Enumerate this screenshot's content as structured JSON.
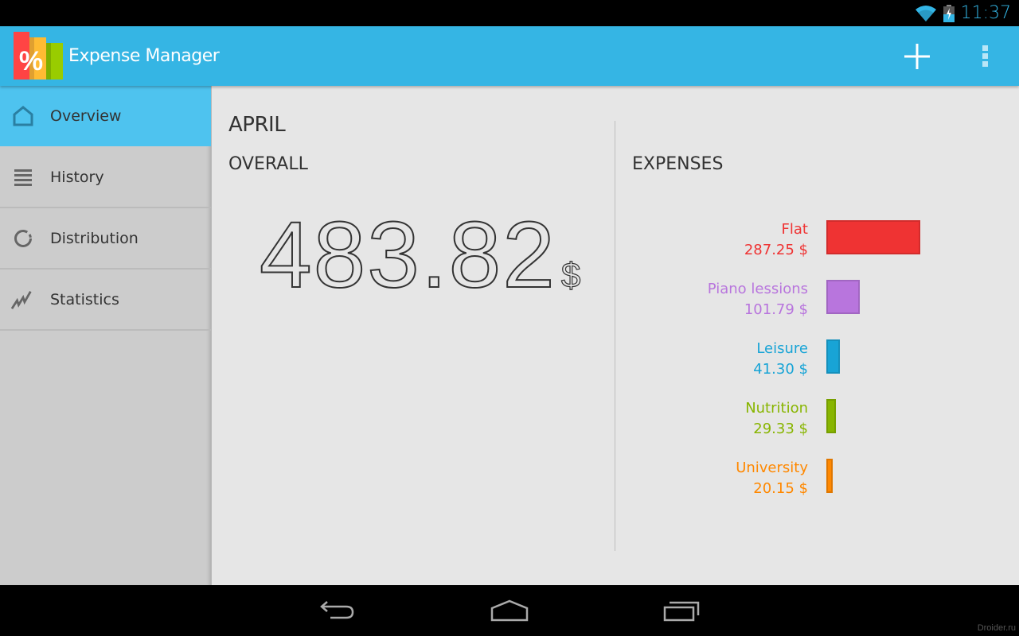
{
  "status_bar": {
    "time": "11:37",
    "icons": [
      "wifi-icon",
      "battery-charging-icon"
    ]
  },
  "action_bar": {
    "title": "Expense Manager",
    "logo_glyph": "%",
    "add_icon": "plus-icon",
    "overflow_icon": "overflow-menu-icon",
    "colors": {
      "background": "#35b5e4"
    }
  },
  "sidebar": {
    "items": [
      {
        "label": "Overview",
        "icon": "home-icon",
        "active": true
      },
      {
        "label": "History",
        "icon": "list-icon",
        "active": false
      },
      {
        "label": "Distribution",
        "icon": "donut-icon",
        "active": false
      },
      {
        "label": "Statistics",
        "icon": "chart-line-icon",
        "active": false
      }
    ]
  },
  "overview": {
    "month": "APRIL",
    "overall_label": "OVERALL",
    "total": "483.82",
    "currency": "$",
    "expenses_label": "EXPENSES",
    "expenses": [
      {
        "name": "Flat",
        "amount": "287.25 $",
        "value": 287.25,
        "color": "#ef3333"
      },
      {
        "name": "Piano lessions",
        "amount": "101.79 $",
        "value": 101.79,
        "color": "#b875dd"
      },
      {
        "name": "Leisure",
        "amount": "41.30 $",
        "value": 41.3,
        "color": "#18a4d6"
      },
      {
        "name": "Nutrition",
        "amount": "29.33 $",
        "value": 29.33,
        "color": "#88b500"
      },
      {
        "name": "University",
        "amount": "20.15 $",
        "value": 20.15,
        "color": "#ff8800"
      }
    ]
  },
  "nav_bar": {
    "buttons": [
      "back",
      "home",
      "recents"
    ]
  },
  "watermark": "Droider.ru"
}
